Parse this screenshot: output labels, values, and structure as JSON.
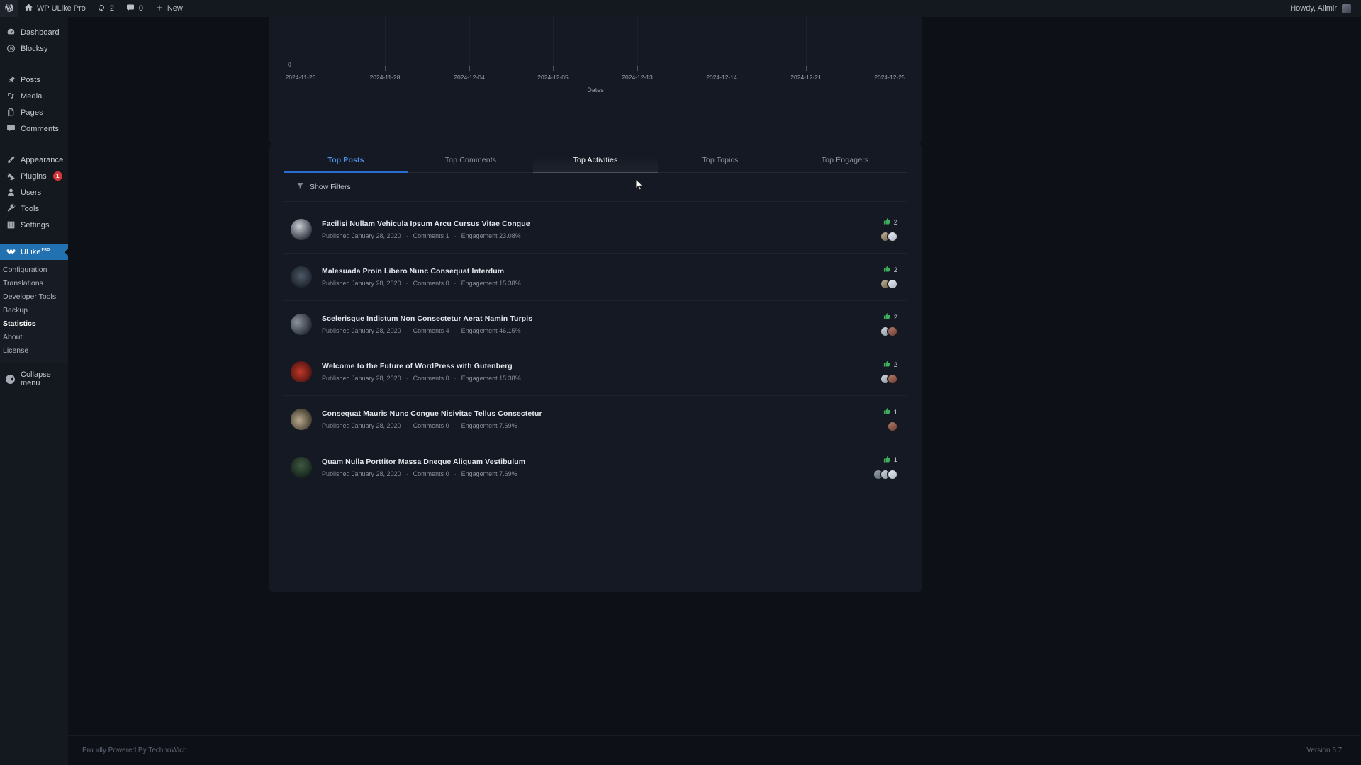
{
  "adminbar": {
    "logo_icon": "wordpress-icon",
    "site_icon": "home-icon",
    "site_name": "WP ULike Pro",
    "updates_icon": "updates-icon",
    "updates_count": "2",
    "comments_icon": "comment-bubble-icon",
    "comments_count": "0",
    "new_icon": "plus-icon",
    "new_label": "New",
    "howdy": "Howdy, Alimir"
  },
  "sidebar": {
    "groups": [
      {
        "items": [
          {
            "label": "Dashboard",
            "icon": "dashboard-icon",
            "name": "sidebar-item-dashboard"
          },
          {
            "label": "Blocksy",
            "icon": "blocksy-icon",
            "name": "sidebar-item-blocksy"
          }
        ]
      },
      {
        "items": [
          {
            "label": "Posts",
            "icon": "pin-icon",
            "name": "sidebar-item-posts"
          },
          {
            "label": "Media",
            "icon": "media-icon",
            "name": "sidebar-item-media"
          },
          {
            "label": "Pages",
            "icon": "pages-icon",
            "name": "sidebar-item-pages"
          },
          {
            "label": "Comments",
            "icon": "comment-icon",
            "name": "sidebar-item-comments"
          }
        ]
      },
      {
        "items": [
          {
            "label": "Appearance",
            "icon": "paintbrush-icon",
            "name": "sidebar-item-appearance"
          },
          {
            "label": "Plugins",
            "icon": "plug-icon",
            "name": "sidebar-item-plugins",
            "badge": "1"
          },
          {
            "label": "Users",
            "icon": "user-icon",
            "name": "sidebar-item-users"
          },
          {
            "label": "Tools",
            "icon": "wrench-icon",
            "name": "sidebar-item-tools"
          },
          {
            "label": "Settings",
            "icon": "sliders-icon",
            "name": "sidebar-item-settings"
          }
        ]
      }
    ],
    "current": {
      "label": "ULike",
      "sup": "PRO",
      "icon": "ulike-icon",
      "name": "sidebar-item-ulike"
    },
    "submenu": [
      {
        "label": "Configuration",
        "name": "submenu-item-configuration",
        "active": false
      },
      {
        "label": "Translations",
        "name": "submenu-item-translations",
        "active": false
      },
      {
        "label": "Developer Tools",
        "name": "submenu-item-developer-tools",
        "active": false
      },
      {
        "label": "Backup",
        "name": "submenu-item-backup",
        "active": false
      },
      {
        "label": "Statistics",
        "name": "submenu-item-statistics",
        "active": true
      },
      {
        "label": "About",
        "name": "submenu-item-about",
        "active": false
      },
      {
        "label": "License",
        "name": "submenu-item-license",
        "active": false
      }
    ],
    "collapse_label": "Collapse menu",
    "collapse_icon": "collapse-arrow-icon",
    "accent_color": "#2271b1"
  },
  "chart_data": {
    "type": "line",
    "title": "",
    "xlabel": "Dates",
    "ylabel": "",
    "categories": [
      "2024-11-26",
      "2024-11-28",
      "2024-12-04",
      "2024-12-05",
      "2024-12-13",
      "2024-12-14",
      "2024-12-21",
      "2024-12-25"
    ],
    "values": [
      0,
      0,
      0,
      0,
      0,
      0,
      0,
      0
    ],
    "ytick_labels": [
      "0"
    ],
    "ylim": [
      0,
      1
    ],
    "grid": true,
    "legend": "none",
    "note": "chart is clipped at top of viewport; only x-axis baseline at 0 is visible"
  },
  "panel": {
    "tabs": [
      {
        "label": "Top Posts",
        "name": "tab-top-posts",
        "state": "active"
      },
      {
        "label": "Top Comments",
        "name": "tab-top-comments",
        "state": "default"
      },
      {
        "label": "Top Activities",
        "name": "tab-top-activities",
        "state": "hovered"
      },
      {
        "label": "Top Topics",
        "name": "tab-top-topics",
        "state": "default"
      },
      {
        "label": "Top Engagers",
        "name": "tab-top-engagers",
        "state": "default"
      }
    ],
    "filter": {
      "label": "Show Filters",
      "icon": "funnel-icon"
    },
    "meta_labels": {
      "published_prefix": "Published",
      "comments_prefix": "Comments",
      "engagement_prefix": "Engagement"
    },
    "posts": [
      {
        "title": "Facilisi Nullam Vehicula Ipsum Arcu Cursus Vitae Congue",
        "published": "Published January 28, 2020",
        "comments": "Comments 1",
        "engagement": "Engagement 23.08%",
        "likes": "2",
        "avatars": 2
      },
      {
        "title": "Malesuada Proin Libero Nunc Consequat Interdum",
        "published": "Published January 28, 2020",
        "comments": "Comments 0",
        "engagement": "Engagement 15.38%",
        "likes": "2",
        "avatars": 2
      },
      {
        "title": "Scelerisque Indictum Non Consectetur Aerat Namin Turpis",
        "published": "Published January 28, 2020",
        "comments": "Comments 4",
        "engagement": "Engagement 46.15%",
        "likes": "2",
        "avatars": 2
      },
      {
        "title": "Welcome to the Future of WordPress with Gutenberg",
        "published": "Published January 28, 2020",
        "comments": "Comments 0",
        "engagement": "Engagement 15.38%",
        "likes": "2",
        "avatars": 2
      },
      {
        "title": "Consequat Mauris Nunc Congue Nisivitae Tellus Consectetur",
        "published": "Published January 28, 2020",
        "comments": "Comments 0",
        "engagement": "Engagement 7.69%",
        "likes": "1",
        "avatars": 1
      },
      {
        "title": "Quam Nulla Porttitor Massa Dneque Aliquam Vestibulum",
        "published": "Published January 28, 2020",
        "comments": "Comments 0",
        "engagement": "Engagement 7.69%",
        "likes": "1",
        "avatars": 3
      }
    ],
    "like_icon": "thumbs-up-icon",
    "like_color": "#3fae5a",
    "active_tab_color": "#4f8fe8"
  },
  "footer": {
    "credit": "Proudly Powered By TechnoWich",
    "version": "Version 6.7."
  }
}
